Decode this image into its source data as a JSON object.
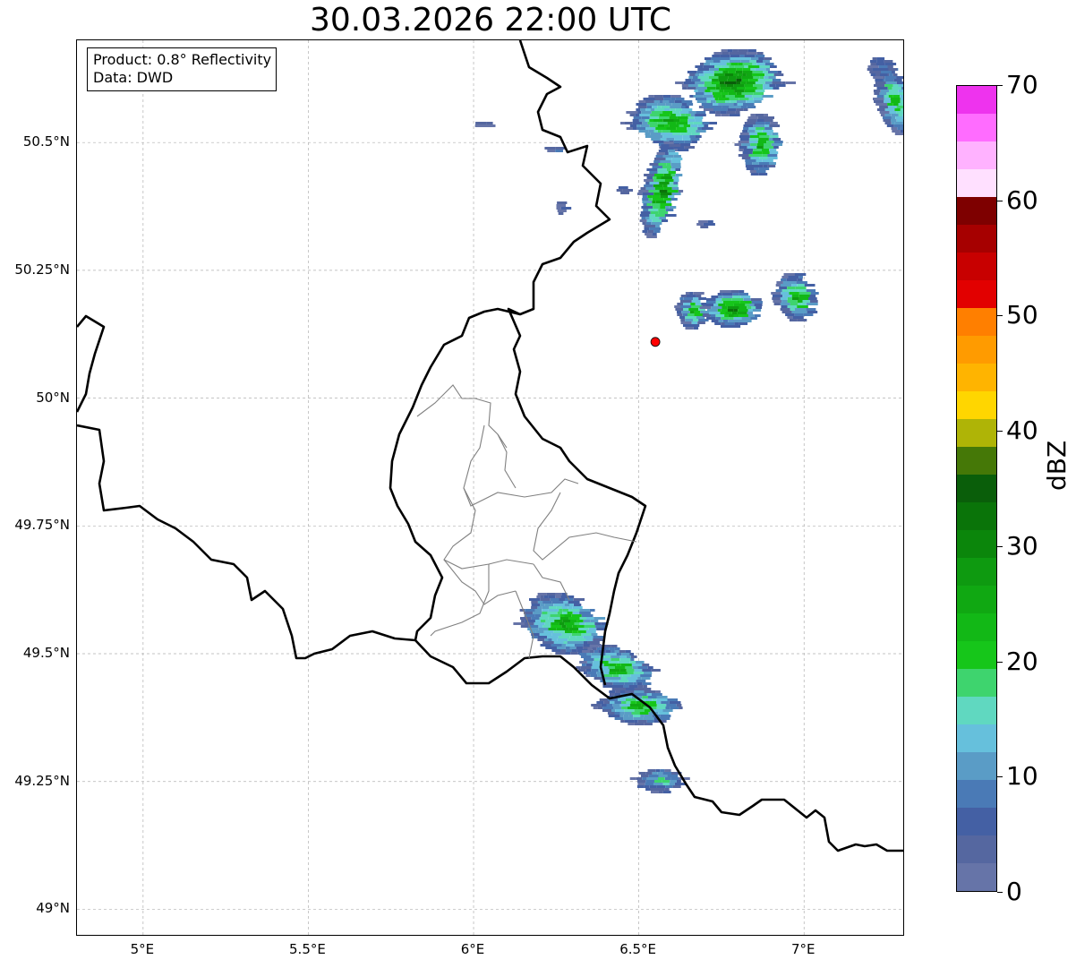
{
  "title": "30.03.2026 22:00 UTC",
  "info_box": {
    "product": "Product: 0.8° Reflectivity",
    "data": "Data: DWD"
  },
  "map": {
    "lon_range": [
      4.8,
      7.3
    ],
    "lat_range": [
      48.95,
      50.7
    ],
    "x_ticks": [
      "5°E",
      "5.5°E",
      "6°E",
      "6.5°E",
      "7°E"
    ],
    "y_ticks": [
      "49°N",
      "49.25°N",
      "49.5°N",
      "49.75°N",
      "50°N",
      "50.25°N",
      "50.5°N"
    ],
    "gridlines": true,
    "radar_site_marker": {
      "lon": 6.55,
      "lat": 50.11,
      "color": "#ff0000"
    }
  },
  "colorbar": {
    "label": "dBZ",
    "range": [
      0,
      70
    ],
    "step_dbz": 2.5,
    "tick_labels": [
      "0",
      "10",
      "20",
      "30",
      "40",
      "50",
      "60",
      "70"
    ],
    "colors": [
      "#6674a8",
      "#5567a0",
      "#4460a4",
      "#4a7ab6",
      "#5a9cc6",
      "#66c0dc",
      "#60d8c0",
      "#3ed46e",
      "#16c61a",
      "#12b816",
      "#10a812",
      "#0e9a10",
      "#0b860b",
      "#0a7409",
      "#0a5e0a",
      "#457807",
      "#afb406",
      "#ffd600",
      "#ffb400",
      "#ff9b00",
      "#ff7f00",
      "#e20000",
      "#c80000",
      "#a60000",
      "#7e0000",
      "#ffe0ff",
      "#ffb2ff",
      "#ff6cff",
      "#ee33ee"
    ]
  }
}
